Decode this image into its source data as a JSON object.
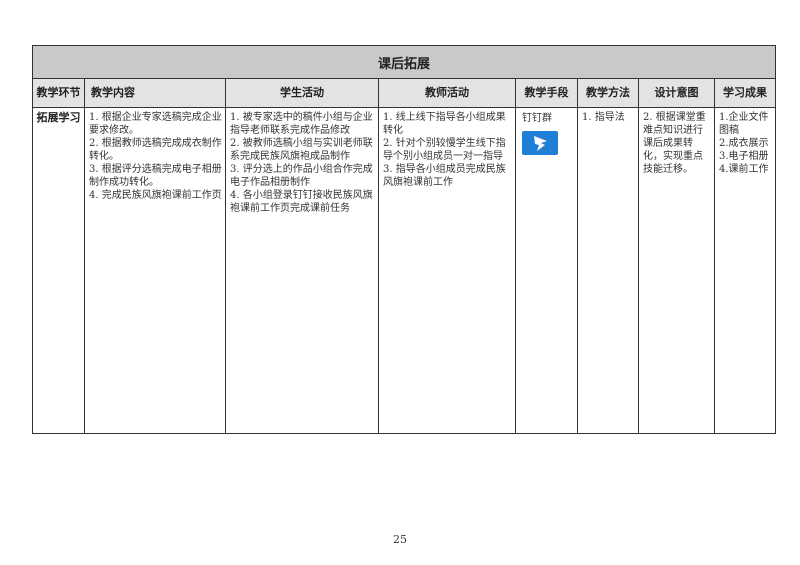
{
  "table": {
    "title": "课后拓展",
    "headers": [
      "教学环节",
      "教学内容",
      "学生活动",
      "教师活动",
      "教学手段",
      "教学方法",
      "设计意图",
      "学习成果"
    ],
    "row": {
      "stage": "拓展学习",
      "content": [
        "1. 根据企业专家选稿完成企业要求修改。",
        "2. 根据教师选稿完成成衣制作转化。",
        "3. 根据评分选稿完成电子相册制作成功转化。",
        "4. 完成民族风旗袍课前工作页"
      ],
      "student": [
        "1. 被专家选中的稿件小组与企业指导老师联系完成作品修改",
        "2. 被教师选稿小组与实训老师联系完成民族风旗袍成品制作",
        "3. 评分选上的作品小组合作完成电子作品相册制作",
        "4. 各小组登录钉钉接收民族风旗袍课前工作页完成课前任务"
      ],
      "teacher": [
        "1. 线上线下指导各小组成果转化",
        "2. 针对个别较慢学生线下指导个别小组成员一对一指导",
        "3. 指导各小组成员完成民族风旗袍课前工作"
      ],
      "tool": {
        "label": "钉钉群",
        "icon": "dingtalk-icon",
        "icon_color": "#1f7fd6"
      },
      "method": [
        "1. 指导法"
      ],
      "intent": [
        "2. 根据课堂重难点知识进行课后成果转化，实现重点技能迁移。"
      ],
      "outcome": [
        "1.企业文件图稿",
        "2.成衣展示",
        "3.电子相册",
        "4.课前工作"
      ]
    }
  },
  "footer": {
    "page_number": "25"
  }
}
